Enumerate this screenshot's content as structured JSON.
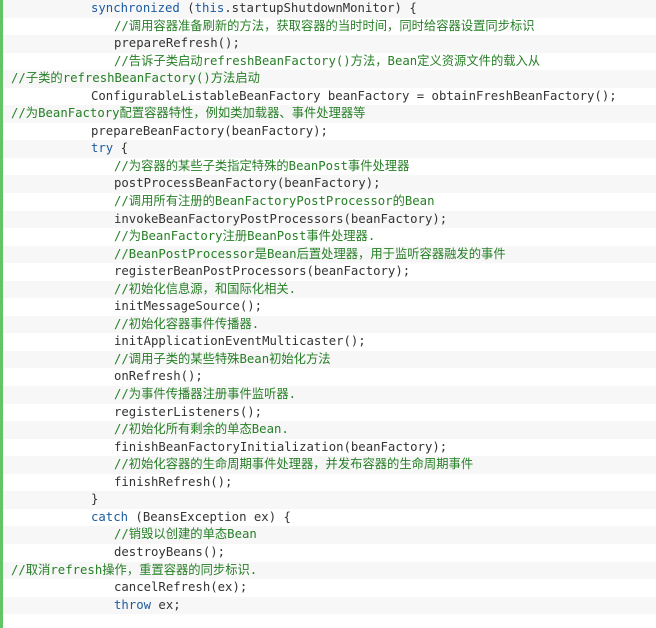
{
  "editor": {
    "name": "code-snippet-viewer",
    "language": "java",
    "colors": {
      "comment": "#267f26",
      "keyword": "#1d5b9e",
      "plain": "#333333",
      "background": "#ffffff",
      "stripe_background": "#f7f7f7",
      "left_accent": "#62c462"
    },
    "line_count": 35
  },
  "lines": [
    {
      "n": 1,
      "indent": 88,
      "tokens": [
        {
          "t": "kw",
          "v": "synchronized"
        },
        {
          "t": "pl",
          "v": " ("
        },
        {
          "t": "kw",
          "v": "this"
        },
        {
          "t": "pl",
          "v": ".startupShutdownMonitor) {"
        }
      ]
    },
    {
      "n": 2,
      "indent": 111,
      "tokens": [
        {
          "t": "cmt",
          "v": "//调用容器准备刷新的方法，获取容器的当时时间，同时给容器设置同步标识"
        }
      ]
    },
    {
      "n": 3,
      "indent": 111,
      "tokens": [
        {
          "t": "pl",
          "v": "prepareRefresh();"
        }
      ]
    },
    {
      "n": 4,
      "indent": 111,
      "tokens": [
        {
          "t": "cmt",
          "v": "//告诉子类启动refreshBeanFactory()方法，Bean定义资源文件的载入从"
        }
      ]
    },
    {
      "n": 5,
      "indent": 8,
      "tokens": [
        {
          "t": "cmt",
          "v": "//子类的refreshBeanFactory()方法启动"
        }
      ]
    },
    {
      "n": 6,
      "indent": 88,
      "tokens": [
        {
          "t": "pl",
          "v": "ConfigurableListableBeanFactory beanFactory = obtainFreshBeanFactory();"
        }
      ]
    },
    {
      "n": 7,
      "indent": 8,
      "tokens": [
        {
          "t": "cmt",
          "v": "//为BeanFactory配置容器特性，例如类加载器、事件处理器等"
        }
      ]
    },
    {
      "n": 8,
      "indent": 88,
      "tokens": [
        {
          "t": "pl",
          "v": "prepareBeanFactory(beanFactory);"
        }
      ]
    },
    {
      "n": 9,
      "indent": 88,
      "tokens": [
        {
          "t": "kw",
          "v": "try"
        },
        {
          "t": "pl",
          "v": " {"
        }
      ]
    },
    {
      "n": 10,
      "indent": 111,
      "tokens": [
        {
          "t": "cmt",
          "v": "//为容器的某些子类指定特殊的BeanPost事件处理器"
        }
      ]
    },
    {
      "n": 11,
      "indent": 111,
      "tokens": [
        {
          "t": "pl",
          "v": "postProcessBeanFactory(beanFactory);"
        }
      ]
    },
    {
      "n": 12,
      "indent": 111,
      "tokens": [
        {
          "t": "cmt",
          "v": "//调用所有注册的BeanFactoryPostProcessor的Bean"
        }
      ]
    },
    {
      "n": 13,
      "indent": 111,
      "tokens": [
        {
          "t": "pl",
          "v": "invokeBeanFactoryPostProcessors(beanFactory);"
        }
      ]
    },
    {
      "n": 14,
      "indent": 111,
      "tokens": [
        {
          "t": "cmt",
          "v": "//为BeanFactory注册BeanPost事件处理器."
        }
      ]
    },
    {
      "n": 15,
      "indent": 111,
      "tokens": [
        {
          "t": "cmt",
          "v": "//BeanPostProcessor是Bean后置处理器，用于监听容器融发的事件"
        }
      ]
    },
    {
      "n": 16,
      "indent": 111,
      "tokens": [
        {
          "t": "pl",
          "v": "registerBeanPostProcessors(beanFactory);"
        }
      ]
    },
    {
      "n": 17,
      "indent": 111,
      "tokens": [
        {
          "t": "cmt",
          "v": "//初始化信息源，和国际化相关."
        }
      ]
    },
    {
      "n": 18,
      "indent": 111,
      "tokens": [
        {
          "t": "pl",
          "v": "initMessageSource();"
        }
      ]
    },
    {
      "n": 19,
      "indent": 111,
      "tokens": [
        {
          "t": "cmt",
          "v": "//初始化容器事件传播器."
        }
      ]
    },
    {
      "n": 20,
      "indent": 111,
      "tokens": [
        {
          "t": "pl",
          "v": "initApplicationEventMulticaster();"
        }
      ]
    },
    {
      "n": 21,
      "indent": 111,
      "tokens": [
        {
          "t": "cmt",
          "v": "//调用子类的某些特殊Bean初始化方法"
        }
      ]
    },
    {
      "n": 22,
      "indent": 111,
      "tokens": [
        {
          "t": "pl",
          "v": "onRefresh();"
        }
      ]
    },
    {
      "n": 23,
      "indent": 111,
      "tokens": [
        {
          "t": "cmt",
          "v": "//为事件传播器注册事件监听器."
        }
      ]
    },
    {
      "n": 24,
      "indent": 111,
      "tokens": [
        {
          "t": "pl",
          "v": "registerListeners();"
        }
      ]
    },
    {
      "n": 25,
      "indent": 111,
      "tokens": [
        {
          "t": "cmt",
          "v": "//初始化所有剩余的单态Bean."
        }
      ]
    },
    {
      "n": 26,
      "indent": 111,
      "tokens": [
        {
          "t": "pl",
          "v": "finishBeanFactoryInitialization(beanFactory);"
        }
      ]
    },
    {
      "n": 27,
      "indent": 111,
      "tokens": [
        {
          "t": "cmt",
          "v": "//初始化容器的生命周期事件处理器，并发布容器的生命周期事件"
        }
      ]
    },
    {
      "n": 28,
      "indent": 111,
      "tokens": [
        {
          "t": "pl",
          "v": "finishRefresh();"
        }
      ]
    },
    {
      "n": 29,
      "indent": 88,
      "tokens": [
        {
          "t": "pl",
          "v": "}"
        }
      ]
    },
    {
      "n": 30,
      "indent": 88,
      "tokens": [
        {
          "t": "kw",
          "v": "catch"
        },
        {
          "t": "pl",
          "v": " (BeansException ex) {"
        }
      ]
    },
    {
      "n": 31,
      "indent": 111,
      "tokens": [
        {
          "t": "cmt",
          "v": "//销毁以创建的单态Bean"
        }
      ]
    },
    {
      "n": 32,
      "indent": 111,
      "tokens": [
        {
          "t": "pl",
          "v": "destroyBeans();"
        }
      ]
    },
    {
      "n": 33,
      "indent": 8,
      "tokens": [
        {
          "t": "cmt",
          "v": "//取消refresh操作，重置容器的同步标识."
        }
      ]
    },
    {
      "n": 34,
      "indent": 111,
      "tokens": [
        {
          "t": "pl",
          "v": "cancelRefresh(ex);"
        }
      ]
    },
    {
      "n": 35,
      "indent": 111,
      "tokens": [
        {
          "t": "kw",
          "v": "throw"
        },
        {
          "t": "pl",
          "v": " ex;"
        }
      ]
    }
  ]
}
